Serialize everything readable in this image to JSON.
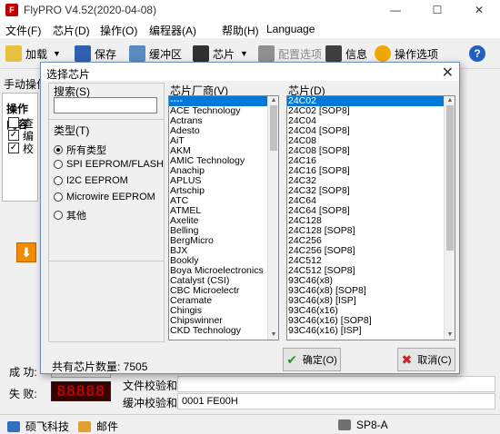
{
  "app": {
    "title": "FlyPRO V4.52(2020-04-08)",
    "icon_letter": "F",
    "min_glyph": "—",
    "max_glyph": "☐",
    "close_glyph": "✕"
  },
  "menu": [
    "文件(F)",
    "芯片(D)",
    "操作(O)",
    "编程器(A)",
    "帮助(H)",
    "Language"
  ],
  "toolbar": {
    "load": "加载",
    "save": "保存",
    "buffer": "缓冲区",
    "chip": "芯片",
    "config": "配置选项",
    "info": "信息",
    "options": "操作选项",
    "caret": "▼",
    "help_glyph": "?"
  },
  "left": {
    "tab_label": "手动操作",
    "section_label": "操作内容",
    "items": [
      {
        "text": "查",
        "checked": false
      },
      {
        "text": "编",
        "checked": true
      },
      {
        "text": "校",
        "checked": true
      }
    ],
    "orange_glyph": "⬇"
  },
  "status": {
    "success_label": "成 功:",
    "fail_label": "失 败:",
    "fail_count": "88888",
    "file_checksum_label": "文件校验和:",
    "file_checksum_value": "",
    "buffer_checksum_label": "缓冲校验和:",
    "buffer_checksum_value": "0001 FE00H"
  },
  "statusbar": {
    "company": "硕飞科技",
    "mail": "邮件",
    "device": "SP8-A"
  },
  "dialog": {
    "title": "选择芯片",
    "close_glyph": "✕",
    "search_label": "搜索(S)",
    "search_value": "",
    "type_label": "类型(T)",
    "types": [
      {
        "label": "所有类型",
        "selected": true
      },
      {
        "label": "SPI EEPROM/FLASH",
        "selected": false
      },
      {
        "label": "I2C EEPROM",
        "selected": false
      },
      {
        "label": "Microwire EEPROM",
        "selected": false
      },
      {
        "label": "其他",
        "selected": false
      }
    ],
    "vendor_label": "芯片厂商(V)",
    "vendors": [
      "----",
      "ACE Technology",
      "Actrans",
      "Adesto",
      "AiT",
      "AKM",
      "AMIC Technology",
      "Anachip",
      "APLUS",
      "Artschip",
      "ATC",
      "ATMEL",
      "Axelite",
      "Belling",
      "BergMicro",
      "BJX",
      "Bookly",
      "Boya Microelectronics",
      "Catalyst (CSI)",
      "CBC Microelectr",
      "Ceramate",
      "Chingis",
      "Chipswinner",
      "CKD Technology"
    ],
    "chip_label": "芯片(D)",
    "chips": [
      "24C02",
      "24C02 [SOP8]",
      "24C04",
      "24C04 [SOP8]",
      "24C08",
      "24C08 [SOP8]",
      "24C16",
      "24C16 [SOP8]",
      "24C32",
      "24C32 [SOP8]",
      "24C64",
      "24C64 [SOP8]",
      "24C128",
      "24C128 [SOP8]",
      "24C256",
      "24C256 [SOP8]",
      "24C512",
      "24C512 [SOP8]",
      "93C46(x8)",
      "93C46(x8) [SOP8]",
      "93C46(x8) [ISP]",
      "93C46(x16)",
      "93C46(x16) [SOP8]",
      "93C46(x16) [ISP]"
    ],
    "count_text": "共有芯片数量: 7505",
    "ok_label": "确定(O)",
    "ok_glyph": "✔",
    "cancel_label": "取消(C)",
    "cancel_glyph": "✖"
  },
  "colors": {
    "selection": "#0078d7",
    "orange": "#f08c00",
    "segment_text": "#e00000"
  }
}
